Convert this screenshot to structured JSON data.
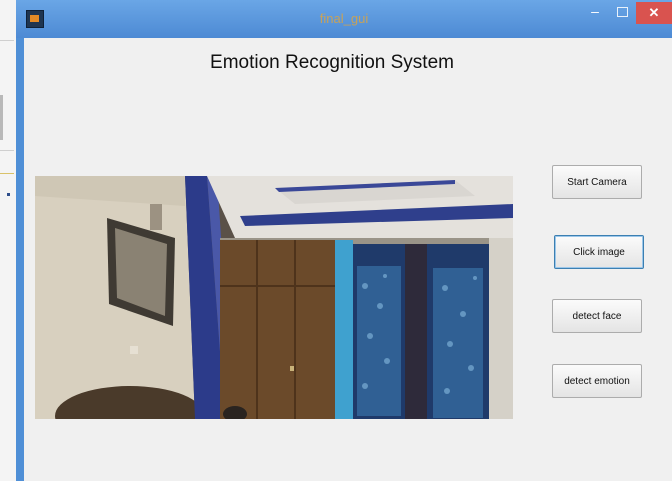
{
  "window": {
    "title": "final_gui",
    "controls": {
      "minimize": "–",
      "close": "✕"
    },
    "accent_color": "#4f8fd6",
    "close_color": "#d9534f",
    "icon": "matlab-figure-icon"
  },
  "main": {
    "title": "Emotion Recognition System",
    "camera_view": {
      "content": "live camera frame of a room interior"
    }
  },
  "buttons": {
    "start_camera": "Start Camera",
    "click_image": "Click image",
    "detect_face": "detect face",
    "detect_emotion": "detect emotion"
  }
}
